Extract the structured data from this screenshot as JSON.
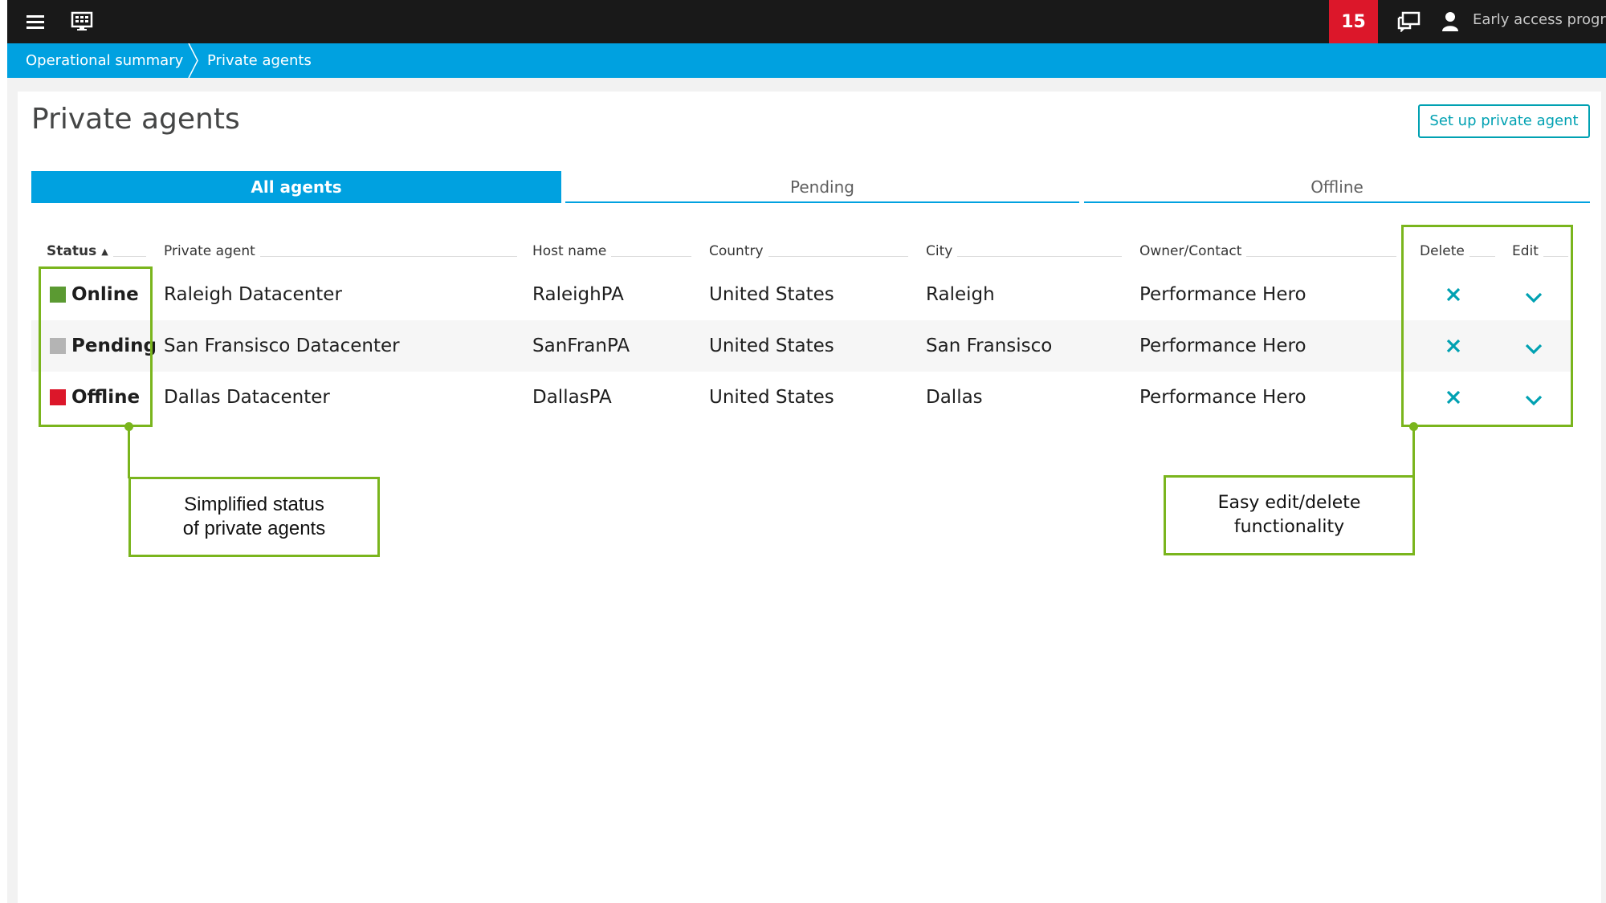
{
  "topbar": {
    "notification_count": "15",
    "user_label": "Early access program",
    "icons": [
      "menu-icon",
      "monitor-icon",
      "chat-icon",
      "user-icon"
    ]
  },
  "breadcrumb": {
    "items": [
      "Operational summary",
      "Private agents"
    ]
  },
  "page": {
    "title": "Private agents",
    "setup_button": "Set up private agent"
  },
  "tabs": [
    {
      "label": "All agents",
      "active": true
    },
    {
      "label": "Pending",
      "active": false
    },
    {
      "label": "Offline",
      "active": false
    }
  ],
  "table": {
    "columns": {
      "status": "Status",
      "agent": "Private agent",
      "host": "Host name",
      "country": "Country",
      "city": "City",
      "owner": "Owner/Contact",
      "delete": "Delete",
      "edit": "Edit"
    },
    "sort_indicator": "▲",
    "rows": [
      {
        "status": "Online",
        "status_color": "#5b9a32",
        "agent": "Raleigh Datacenter",
        "host": "RaleighPA",
        "country": "United States",
        "city": "Raleigh",
        "owner": "Performance Hero"
      },
      {
        "status": "Pending",
        "status_color": "#b4b4b4",
        "agent": "San Fransisco Datacenter",
        "host": "SanFranPA",
        "country": "United States",
        "city": "San Fransisco",
        "owner": "Performance Hero"
      },
      {
        "status": "Offline",
        "status_color": "#dc172a",
        "agent": "Dallas Datacenter",
        "host": "DallasPA",
        "country": "United States",
        "city": "Dallas",
        "owner": "Performance Hero"
      }
    ]
  },
  "annotations": {
    "status_line1": "Simplified status",
    "status_line2": "of private agents",
    "actions_line1": "Easy edit/delete",
    "actions_line2": "functionality"
  },
  "colors": {
    "topbar": "#191919",
    "accent": "#00a1e0",
    "action": "#00a1b2",
    "notification": "#dc172a",
    "annotation": "#7ab51d"
  }
}
